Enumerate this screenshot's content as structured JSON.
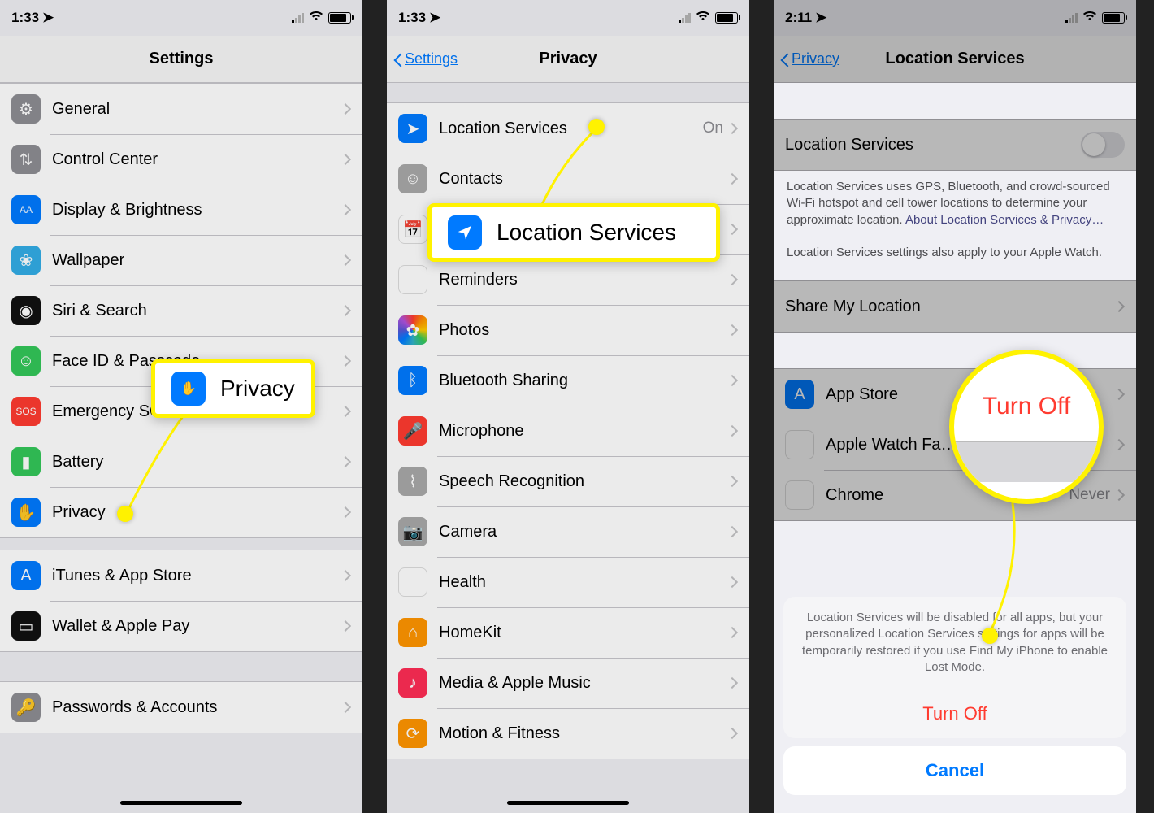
{
  "panel1": {
    "time": "1:33",
    "title": "Settings",
    "rows_g1": [
      {
        "icon": "gear-icon",
        "cls": "ic-gray",
        "label": "General"
      },
      {
        "icon": "toggles-icon",
        "cls": "ic-gray",
        "label": "Control Center"
      },
      {
        "icon": "textsize-icon",
        "cls": "ic-blue",
        "label": "Display & Brightness"
      },
      {
        "icon": "flower-icon",
        "cls": "ic-cyan",
        "label": "Wallpaper"
      },
      {
        "icon": "siri-icon",
        "cls": "ic-black",
        "label": "Siri & Search"
      },
      {
        "icon": "faceid-icon",
        "cls": "ic-green",
        "label": "Face ID & Passcode"
      },
      {
        "icon": "sos-icon",
        "cls": "ic-red",
        "label": "Emergency SOS"
      },
      {
        "icon": "battery-icon",
        "cls": "ic-green",
        "label": "Battery"
      },
      {
        "icon": "hand-icon",
        "cls": "ic-blue",
        "label": "Privacy"
      }
    ],
    "rows_g2": [
      {
        "icon": "appstore-icon",
        "cls": "ic-blue",
        "label": "iTunes & App Store"
      },
      {
        "icon": "wallet-icon",
        "cls": "ic-black",
        "label": "Wallet & Apple Pay"
      }
    ],
    "rows_g3": [
      {
        "icon": "key-icon",
        "cls": "ic-gray",
        "label": "Passwords & Accounts"
      }
    ],
    "callout": "Privacy"
  },
  "panel2": {
    "time": "1:33",
    "back": "Settings",
    "title": "Privacy",
    "rows": [
      {
        "icon": "location-icon",
        "cls": "ic-blue",
        "label": "Location Services",
        "value": "On"
      },
      {
        "icon": "contacts-icon",
        "cls": "ic-lgray",
        "label": "Contacts"
      },
      {
        "icon": "calendar-icon",
        "cls": "ic-white",
        "label": "Calendars"
      },
      {
        "icon": "reminders-icon",
        "cls": "ic-white",
        "label": "Reminders"
      },
      {
        "icon": "photos-icon",
        "cls": "ic-multicolor",
        "label": "Photos"
      },
      {
        "icon": "bluetooth-icon",
        "cls": "ic-blue",
        "label": "Bluetooth Sharing"
      },
      {
        "icon": "mic-icon",
        "cls": "ic-red",
        "label": "Microphone"
      },
      {
        "icon": "speech-icon",
        "cls": "ic-lgray",
        "label": "Speech Recognition"
      },
      {
        "icon": "camera-icon",
        "cls": "ic-lgray",
        "label": "Camera"
      },
      {
        "icon": "health-icon",
        "cls": "ic-white",
        "label": "Health"
      },
      {
        "icon": "homekit-icon",
        "cls": "ic-orange",
        "label": "HomeKit"
      },
      {
        "icon": "music-icon",
        "cls": "ic-pink",
        "label": "Media & Apple Music"
      },
      {
        "icon": "motion-icon",
        "cls": "ic-orange",
        "label": "Motion & Fitness"
      }
    ],
    "callout": "Location Services"
  },
  "panel3": {
    "time": "2:11",
    "back": "Privacy",
    "title": "Location Services",
    "toggle_label": "Location Services",
    "desc1": "Location Services uses GPS, Bluetooth, and crowd-sourced Wi-Fi hotspot and cell tower locations to determine your approximate location.",
    "desc1_link": "About Location Services & Privacy…",
    "desc2": "Location Services settings also apply to your Apple Watch.",
    "share_label": "Share My Location",
    "apps": [
      {
        "icon": "appstore-icon",
        "cls": "ic-blue",
        "label": "App Store"
      },
      {
        "icon": "watch-icon",
        "cls": "ic-white",
        "label": "Apple Watch Fa…"
      },
      {
        "icon": "chrome-icon",
        "cls": "ic-white",
        "label": "Chrome",
        "value": "Never"
      }
    ],
    "sheet_text": "Location Services will be disabled for all apps, but your personalized Location Services settings for apps will be temporarily restored if you use Find My iPhone to enable Lost Mode.",
    "sheet_turnoff": "Turn Off",
    "sheet_cancel": "Cancel",
    "callout": "Turn Off"
  }
}
